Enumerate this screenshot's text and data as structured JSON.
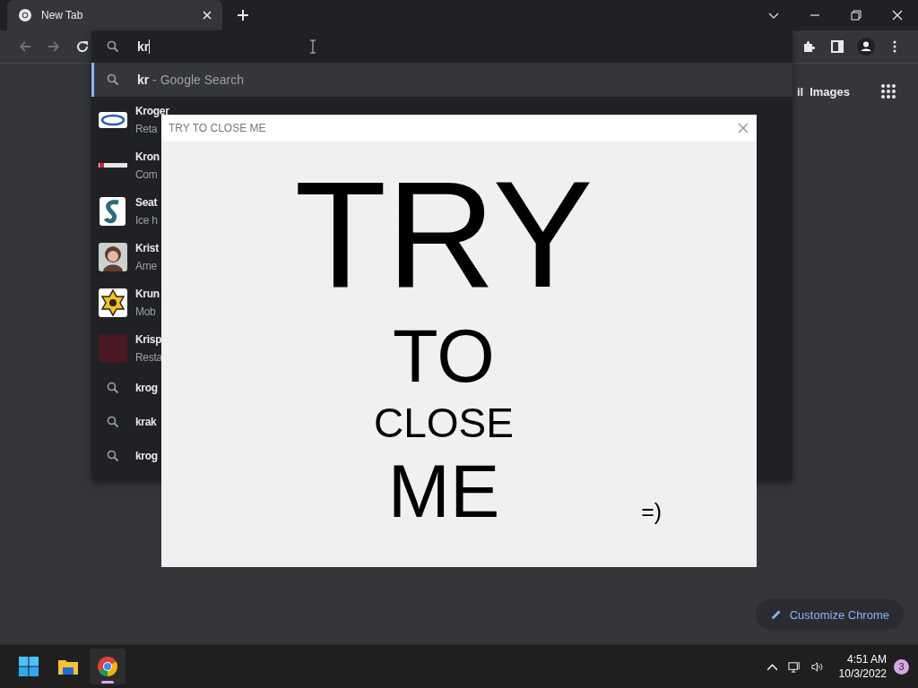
{
  "tab": {
    "title": "New Tab",
    "selected": true
  },
  "omnibox": {
    "value": "kr"
  },
  "suggestions": [
    {
      "kind": "search",
      "text": "**kr** - Google Search",
      "selected": true
    },
    {
      "kind": "entity",
      "title": "Kroger",
      "subtitle": "Reta",
      "selected": false
    },
    {
      "kind": "entity",
      "title": "Kron",
      "subtitle": "Com",
      "selected": false
    },
    {
      "kind": "entity",
      "title": "Seat",
      "subtitle": "Ice h",
      "selected": false
    },
    {
      "kind": "entity",
      "title": "Krist",
      "subtitle": "Ame",
      "selected": false
    },
    {
      "kind": "entity",
      "title": "Krun",
      "subtitle": "Mob",
      "selected": false
    },
    {
      "kind": "entity",
      "title": "Krisp",
      "subtitle": "Resta",
      "selected": false
    },
    {
      "kind": "search",
      "text": "krog",
      "selected": false
    },
    {
      "kind": "search",
      "text": "krak",
      "selected": false
    },
    {
      "kind": "search",
      "text": "krog",
      "selected": false
    }
  ],
  "top_links": [
    "il",
    "Images"
  ],
  "dialog": {
    "title": "TRY TO CLOSE ME",
    "lines": [
      "TRY",
      "TO",
      "CLOSE",
      "ME"
    ],
    "smiley": "=)"
  },
  "customize_button": "Customize Chrome",
  "taskbar": {
    "apps": [
      {
        "kind": "start",
        "selected": false
      },
      {
        "kind": "files",
        "selected": false
      },
      {
        "kind": "chrome",
        "selected": true
      }
    ],
    "time": "4:51 AM",
    "date": "10/3/2022",
    "badge": "3"
  }
}
